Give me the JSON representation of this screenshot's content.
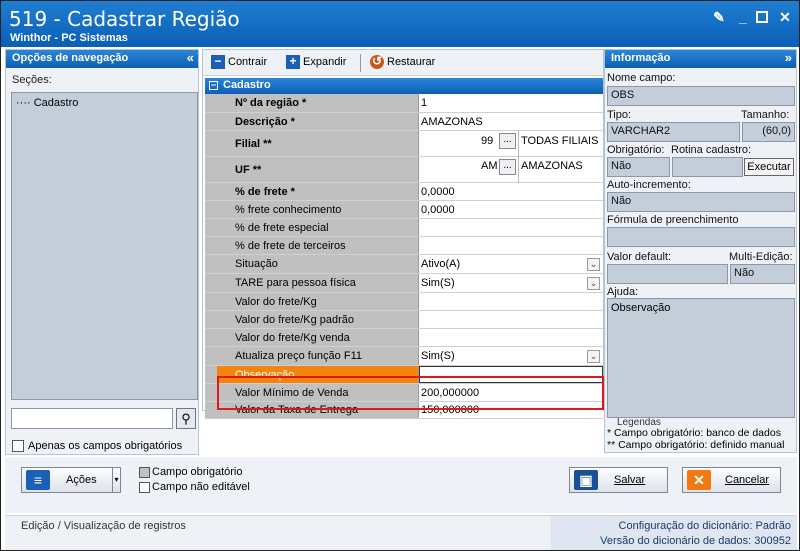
{
  "window": {
    "title": "519 - Cadastrar Região",
    "subtitle": "Winthor - PC Sistemas"
  },
  "left_panel": {
    "title": "Opções de navegação",
    "sections_label": "Seções:",
    "sections": [
      "Cadastro"
    ],
    "only_required_label": "Apenas os campos obrigatórios"
  },
  "toolbar": {
    "collapse_label": "Contrair",
    "expand_label": "Expandir",
    "restore_label": "Restaurar"
  },
  "form": {
    "section_title": "Cadastro",
    "rows": [
      {
        "label": "Nº da região *",
        "value": "1"
      },
      {
        "label": "Descrição *",
        "value": "AMAZONAS"
      },
      {
        "label": "Filial **",
        "code": "99",
        "desc": "TODAS FILIAIS"
      },
      {
        "label": "UF **",
        "code": "AM",
        "desc": "AMAZONAS"
      },
      {
        "label": "% de frete *",
        "value": "0,0000"
      },
      {
        "label": "% frete conhecimento",
        "value": "0,0000"
      },
      {
        "label": "% de frete especial",
        "value": ""
      },
      {
        "label": "% de frete de terceiros",
        "value": ""
      },
      {
        "label": "Situação",
        "value": "Ativo(A)"
      },
      {
        "label": "TARE para pessoa física",
        "value": "Sim(S)"
      },
      {
        "label": "Valor do frete/Kg",
        "value": ""
      },
      {
        "label": "Valor do frete/Kg padrão",
        "value": ""
      },
      {
        "label": "Valor do frete/Kg venda",
        "value": ""
      },
      {
        "label": "Atualiza preço função F11",
        "value": "Sim(S)"
      },
      {
        "label": "Observação",
        "value": ""
      },
      {
        "label": "Valor Mínimo de Venda",
        "value": "200,000000"
      },
      {
        "label": "Valor da Taxa de Entrega",
        "value": "150,000000"
      }
    ],
    "lookup_button": "..."
  },
  "info_panel": {
    "title": "Informação",
    "field_name_label": "Nome campo:",
    "field_name": "OBS",
    "type_label": "Tipo:",
    "type": "VARCHAR2",
    "size_label": "Tamanho:",
    "size": "(60,0)",
    "required_label": "Obrigatório:",
    "required": "Não",
    "routine_label": "Rotina cadastro:",
    "execute_label": "Executar",
    "autoinc_label": "Auto-incremento:",
    "autoinc": "Não",
    "formula_label": "Fórmula de preenchimento",
    "formula": "",
    "default_label": "Valor default:",
    "default": "",
    "multi_label": "Multi-Edição:",
    "multi": "Não",
    "help_label": "Ajuda:",
    "help": "Observação",
    "legend_title": "Legendas",
    "legend1": "* Campo obrigatório: banco de dados",
    "legend2": "** Campo obrigatório: definido manual"
  },
  "bottom": {
    "actions_label": "Ações",
    "required_field": "Campo obrigatório",
    "non_editable": "Campo não editável",
    "save_label": "Salvar",
    "cancel_label": "Cancelar"
  },
  "status": {
    "left": "Edição / Visualização de registros",
    "dict_config": "Configuração do dicionário: Padrão",
    "dict_version": "Versão do dicionário de dados: 300952"
  },
  "colors": {
    "title_blue": "#0b5fb5",
    "selected_row": "#f3850e",
    "highlight": "#e01818",
    "info_field": "#c4cedb"
  }
}
